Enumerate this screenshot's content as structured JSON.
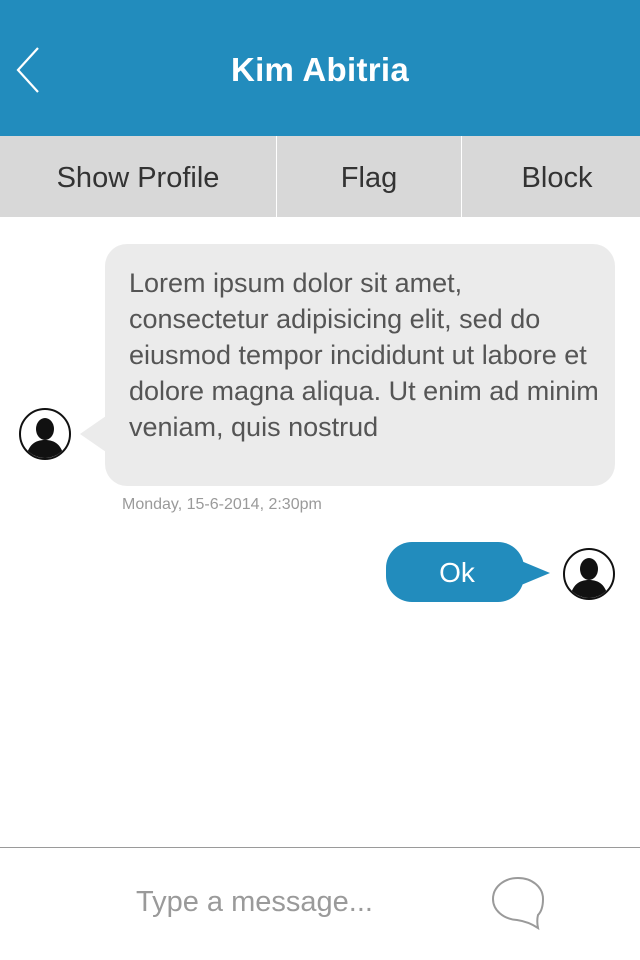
{
  "header": {
    "title": "Kim Abitria",
    "back_icon": "chevron-left-icon"
  },
  "actions": {
    "show_profile": "Show Profile",
    "flag": "Flag",
    "block": "Block"
  },
  "messages": [
    {
      "sender": "other",
      "text": "Lorem ipsum dolor sit amet, consectetur adipisicing elit, sed do eiusmod tempor incididunt ut labore et dolore magna aliqua. Ut enim ad minim veniam, quis nostrud",
      "timestamp": "Monday, 15-6-2014, 2:30pm",
      "avatar_icon": "user-silhouette-icon"
    },
    {
      "sender": "me",
      "text": "Ok",
      "avatar_icon": "user-silhouette-icon"
    }
  ],
  "composer": {
    "placeholder": "Type a message...",
    "send_icon": "speech-bubble-icon"
  },
  "colors": {
    "primary": "#228cbd",
    "action_bar": "#d8d8d8",
    "incoming_bubble": "#ebebeb",
    "text": "#555555",
    "muted": "#9a9a9a"
  }
}
